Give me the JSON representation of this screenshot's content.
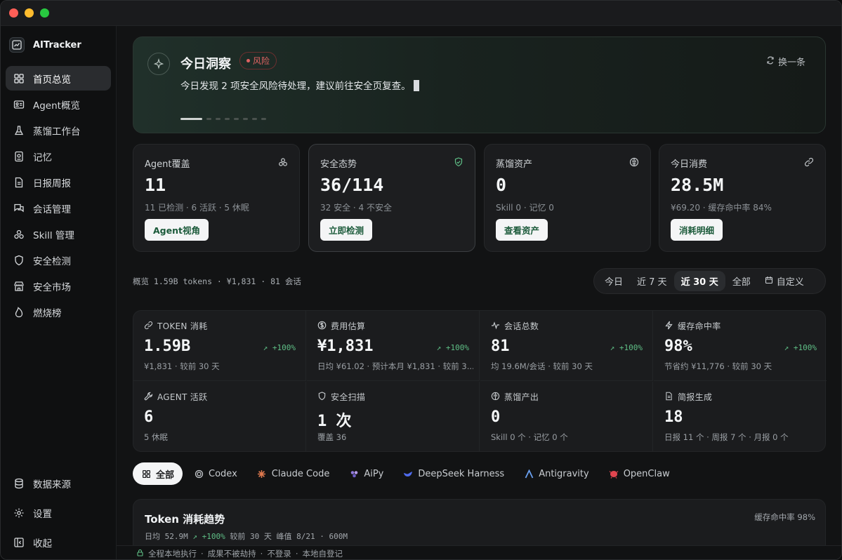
{
  "app": {
    "name": "AITracker"
  },
  "sidebar": {
    "items": [
      {
        "label": "首页总览",
        "icon": "grid-icon",
        "active": true
      },
      {
        "label": "Agent概览",
        "icon": "id-card-icon"
      },
      {
        "label": "蒸馏工作台",
        "icon": "flask-icon"
      },
      {
        "label": "记忆",
        "icon": "memory-icon"
      },
      {
        "label": "日报周报",
        "icon": "document-icon"
      },
      {
        "label": "会话管理",
        "icon": "chat-icon"
      },
      {
        "label": "Skill 管理",
        "icon": "cluster-icon"
      },
      {
        "label": "安全检测",
        "icon": "shield-icon"
      },
      {
        "label": "安全市场",
        "icon": "store-icon"
      },
      {
        "label": "燃烧榜",
        "icon": "flame-icon"
      }
    ],
    "bottom": [
      {
        "label": "数据来源",
        "icon": "database-icon"
      },
      {
        "label": "设置",
        "icon": "gear-icon"
      },
      {
        "label": "收起",
        "icon": "collapse-icon"
      }
    ]
  },
  "insight": {
    "title": "今日洞察",
    "badge": "风险",
    "text": "今日发现 2 项安全风险待处理，建议前往安全页复查。",
    "refresh": "换一条",
    "pages": 8,
    "active_page": 1
  },
  "cards": [
    {
      "title": "Agent覆盖",
      "value": "11",
      "sub": "11 已检测 · 6 活跃 · 5 休眠",
      "button": "Agent视角",
      "icon": "cluster-icon"
    },
    {
      "title": "安全态势",
      "value": "36/114",
      "sub": "32 安全 · 4 不安全",
      "button": "立即检测",
      "icon": "shield-check-icon"
    },
    {
      "title": "蒸馏资产",
      "value": "0",
      "sub": "Skill 0 · 记忆 0",
      "button": "查看资产",
      "icon": "brain-icon"
    },
    {
      "title": "今日消费",
      "value": "28.5M",
      "sub": "¥69.20 · 缓存命中率 84%",
      "button": "消耗明细",
      "icon": "link-icon"
    }
  ],
  "overview": {
    "text": "概览  1.59B tokens · ¥1,831 · 81 会话"
  },
  "range": {
    "options": [
      "今日",
      "近 7 天",
      "近 30 天",
      "全部",
      "自定义"
    ],
    "active": "近 30 天"
  },
  "stats": [
    {
      "label": "TOKEN 消耗",
      "value": "1.59B",
      "trend": "↗ +100%",
      "sub": "¥1,831 · 较前 30 天",
      "icon": "link-icon"
    },
    {
      "label": "费用估算",
      "value": "¥1,831",
      "trend": "↗ +100%",
      "sub": "日均 ¥61.02 · 预计本月 ¥1,831 · 较前 3...",
      "icon": "coin-icon"
    },
    {
      "label": "会话总数",
      "value": "81",
      "trend": "↗ +100%",
      "sub": "均 19.6M/会话 · 较前 30 天",
      "icon": "pulse-icon"
    },
    {
      "label": "缓存命中率",
      "value": "98%",
      "trend": "↗ +100%",
      "sub": "节省约 ¥11,776 · 较前 30 天",
      "icon": "bolt-icon"
    },
    {
      "label": "AGENT 活跃",
      "value": "6",
      "trend": "",
      "sub": "5 休眠",
      "icon": "wrench-icon"
    },
    {
      "label": "安全扫描",
      "value": "1 次",
      "trend": "",
      "sub": "覆盖 36",
      "icon": "shield-icon"
    },
    {
      "label": "蒸馏产出",
      "value": "0",
      "trend": "",
      "sub": "Skill 0 个 · 记忆 0 个",
      "icon": "brain-icon"
    },
    {
      "label": "简报生成",
      "value": "18",
      "trend": "",
      "sub": "日报 11 个 · 周报 7 个 · 月报 0 个",
      "icon": "document-icon"
    }
  ],
  "filters": [
    {
      "label": "全部",
      "icon": "grid-icon",
      "active": true,
      "color": "#1b1c1e"
    },
    {
      "label": "Codex",
      "icon": "codex-icon",
      "color": "#c9cdd1"
    },
    {
      "label": "Claude Code",
      "icon": "claude-icon",
      "color": "#e07a4f"
    },
    {
      "label": "AiPy",
      "icon": "aipy-icon",
      "color": "#8f7ad9"
    },
    {
      "label": "DeepSeek Harness",
      "icon": "deepseek-icon",
      "color": "#4f6bed"
    },
    {
      "label": "Antigravity",
      "icon": "antigravity-icon",
      "color": "#6aa0f0"
    },
    {
      "label": "OpenClaw",
      "icon": "openclaw-icon",
      "color": "#e0454f"
    }
  ],
  "trend": {
    "title": "Token 消耗趋势",
    "daily": "日均 52.9M",
    "change": "↗ +100%",
    "compare": "较前 30 天  峰值 8/21 · 600M",
    "cache": "缓存命中率 98%"
  },
  "footer": {
    "items": [
      "全程本地执行",
      "·",
      "成果不被劫持",
      "·",
      "不登录",
      "·",
      "本地自登记"
    ]
  },
  "colors": {
    "accent_green": "#5fbf86",
    "risk_red": "#e06363",
    "button_text": "#1b5a3a"
  }
}
